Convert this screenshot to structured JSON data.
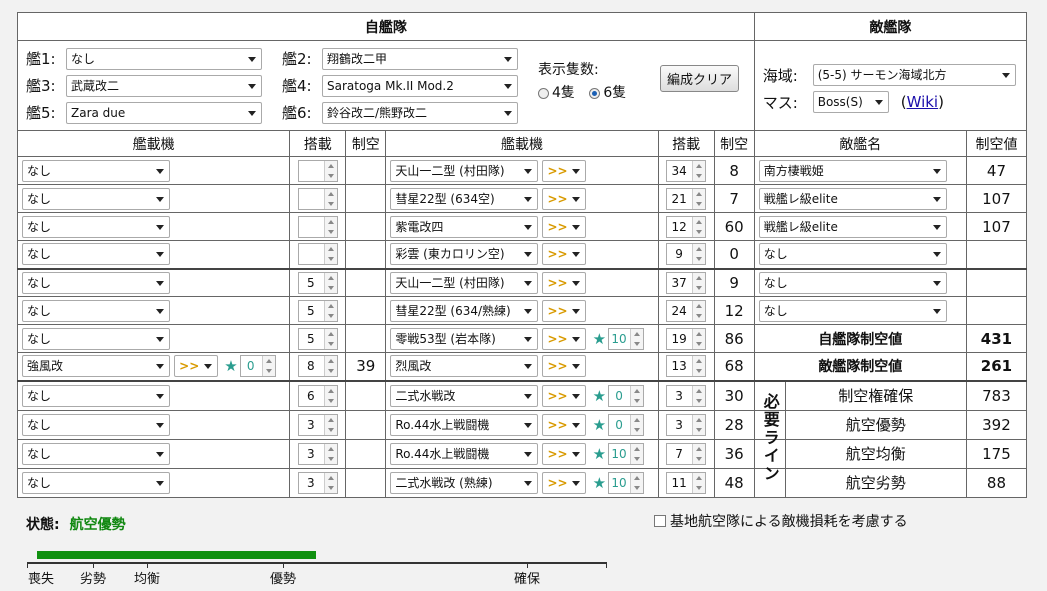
{
  "own_fleet_title": "自艦隊",
  "enemy_fleet_title": "敵艦隊",
  "ships": [
    {
      "label": "艦1:",
      "value": "なし"
    },
    {
      "label": "艦2:",
      "value": "翔鶴改二甲"
    },
    {
      "label": "艦3:",
      "value": "武蔵改二"
    },
    {
      "label": "艦4:",
      "value": "Saratoga Mk.II Mod.2"
    },
    {
      "label": "艦5:",
      "value": "Zara due"
    },
    {
      "label": "艦6:",
      "value": "鈴谷改二/熊野改二"
    }
  ],
  "display_count": {
    "label": "表示隻数:",
    "opt4": "4隻",
    "opt6": "6隻",
    "selected": "6隻"
  },
  "clear_button": "編成クリア",
  "sea_area": {
    "label": "海域:",
    "value": "(5-5) サーモン海域北方"
  },
  "node": {
    "label": "マス:",
    "value": "Boss(S)",
    "wiki_open": "(",
    "wiki": "Wiki",
    "wiki_close": ")"
  },
  "headers": {
    "equip": "艦載機",
    "slots": "搭載",
    "air": "制空",
    "enemy_name": "敵艦名",
    "enemy_air": "制空値"
  },
  "left_rows": [
    {
      "equip": "なし",
      "slot": "",
      "air": ""
    },
    {
      "equip": "なし",
      "slot": "",
      "air": ""
    },
    {
      "equip": "なし",
      "slot": "",
      "air": ""
    },
    {
      "equip": "なし",
      "slot": "",
      "air": ""
    },
    {
      "equip": "なし",
      "slot": "5",
      "air": ""
    },
    {
      "equip": "なし",
      "slot": "5",
      "air": ""
    },
    {
      "equip": "なし",
      "slot": "5",
      "air": ""
    },
    {
      "equip": "強風改",
      "prof": ">>",
      "imp": "0",
      "slot": "8",
      "air": "39"
    },
    {
      "equip": "なし",
      "slot": "6",
      "air": ""
    },
    {
      "equip": "なし",
      "slot": "3",
      "air": ""
    },
    {
      "equip": "なし",
      "slot": "3",
      "air": ""
    },
    {
      "equip": "なし",
      "slot": "3",
      "air": ""
    }
  ],
  "right_rows": [
    {
      "equip": "天山一二型 (村田隊)",
      "prof": ">>",
      "slot": "34",
      "air": "8"
    },
    {
      "equip": "彗星22型 (634空)",
      "prof": ">>",
      "slot": "21",
      "air": "7"
    },
    {
      "equip": "紫電改四",
      "prof": ">>",
      "slot": "12",
      "air": "60"
    },
    {
      "equip": "彩雲 (東カロリン空)",
      "prof": ">>",
      "slot": "9",
      "air": "0"
    },
    {
      "equip": "天山一二型 (村田隊)",
      "prof": ">>",
      "slot": "37",
      "air": "9"
    },
    {
      "equip": "彗星22型 (634/熟練)",
      "prof": ">>",
      "slot": "24",
      "air": "12"
    },
    {
      "equip": "零戦53型 (岩本隊)",
      "prof": ">>",
      "imp": "10",
      "slot": "19",
      "air": "86"
    },
    {
      "equip": "烈風改",
      "prof": ">>",
      "slot": "13",
      "air": "68"
    },
    {
      "equip": "二式水戦改",
      "prof": ">>",
      "imp": "0",
      "slot": "3",
      "air": "30"
    },
    {
      "equip": "Ro.44水上戦闘機",
      "prof": ">>",
      "imp": "0",
      "slot": "3",
      "air": "28"
    },
    {
      "equip": "Ro.44水上戦闘機",
      "prof": ">>",
      "imp": "10",
      "slot": "7",
      "air": "36"
    },
    {
      "equip": "二式水戦改 (熟練)",
      "prof": ">>",
      "imp": "10",
      "slot": "11",
      "air": "48"
    }
  ],
  "enemies": [
    {
      "name": "南方棲戦姫",
      "air": "47"
    },
    {
      "name": "戦艦レ級elite",
      "air": "107"
    },
    {
      "name": "戦艦レ級elite",
      "air": "107"
    },
    {
      "name": "なし",
      "air": ""
    },
    {
      "name": "なし",
      "air": ""
    },
    {
      "name": "なし",
      "air": ""
    }
  ],
  "own_air_label": "自艦隊制空値",
  "own_air_value": "431",
  "enemy_air_label": "敵艦隊制空値",
  "enemy_air_value": "261",
  "required_label": "必要ライン",
  "required": [
    {
      "label": "制空権確保",
      "value": "783"
    },
    {
      "label": "航空優勢",
      "value": "392"
    },
    {
      "label": "航空均衡",
      "value": "175"
    },
    {
      "label": "航空劣勢",
      "value": "88"
    }
  ],
  "status": {
    "label": "状態:",
    "value": "航空優勢",
    "color": "#118811"
  },
  "base_consider": "基地航空隊による敵機損耗を考慮する",
  "air_bar": {
    "fill_fraction": 0.481,
    "color": "#109010"
  },
  "scale_labels": [
    "喪失",
    "劣勢",
    "均衡",
    "優勢",
    "確保"
  ]
}
